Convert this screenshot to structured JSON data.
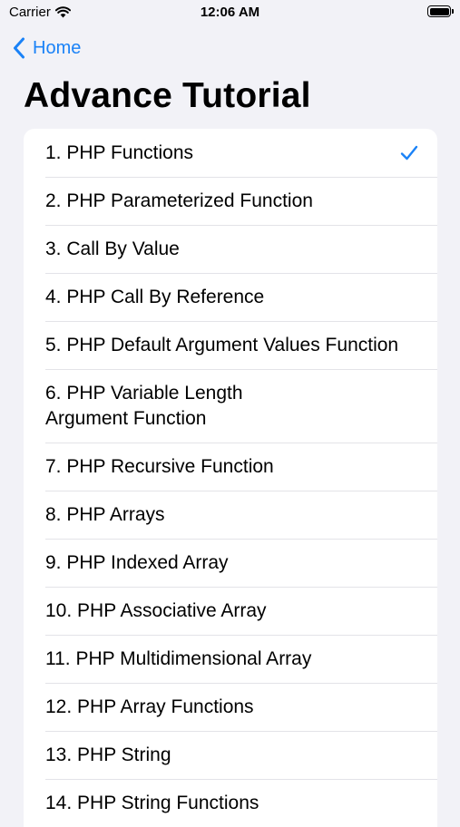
{
  "status_bar": {
    "carrier": "Carrier",
    "time": "12:06 AM",
    "wifi_icon": "wifi-icon",
    "battery_icon": "battery-icon"
  },
  "nav": {
    "back_label": "Home",
    "back_icon": "chevron-left-icon"
  },
  "title": "Advance Tutorial",
  "accent_color": "#1a82f7",
  "items": [
    {
      "label": "1. PHP Functions",
      "selected": true
    },
    {
      "label": "2. PHP Parameterized Function",
      "selected": false
    },
    {
      "label": "3. Call By Value",
      "selected": false
    },
    {
      "label": "4. PHP Call By Reference",
      "selected": false
    },
    {
      "label": "5. PHP Default Argument Values Function",
      "selected": false
    },
    {
      "label": "6. PHP Variable Length\nArgument Function",
      "selected": false
    },
    {
      "label": "7. PHP Recursive Function",
      "selected": false
    },
    {
      "label": "8. PHP Arrays",
      "selected": false
    },
    {
      "label": "9. PHP Indexed Array",
      "selected": false
    },
    {
      "label": "10. PHP Associative Array",
      "selected": false
    },
    {
      "label": "11. PHP Multidimensional Array",
      "selected": false
    },
    {
      "label": "12. PHP Array Functions",
      "selected": false
    },
    {
      "label": "13. PHP String",
      "selected": false
    },
    {
      "label": "14. PHP String Functions",
      "selected": false
    }
  ]
}
